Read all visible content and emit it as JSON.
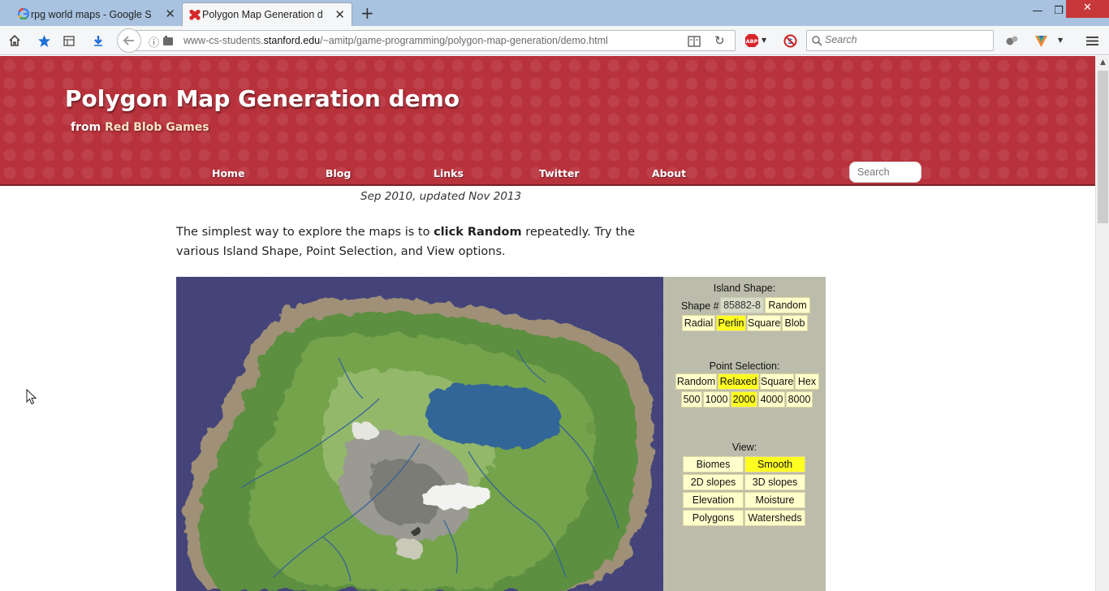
{
  "browser": {
    "tabs": [
      {
        "title": "rpg world maps - Google Se",
        "active": false
      },
      {
        "title": "Polygon Map Generation de",
        "active": true
      }
    ],
    "new_tab": "+",
    "url": {
      "prefix": "www-cs-students.",
      "domain": "stanford.edu",
      "path": "/~amitp/game-programming/polygon-map-generation/demo.html"
    },
    "search_placeholder": "Search",
    "window_controls": {
      "minimize": "—",
      "maximize": "❐",
      "close": "✕"
    }
  },
  "header": {
    "title": "Polygon Map Generation demo",
    "subtitle_prefix": "from ",
    "subtitle_link": "Red Blob Games",
    "nav": [
      "Home",
      "Blog",
      "Links",
      "Twitter",
      "About"
    ],
    "search_placeholder": "Search"
  },
  "content": {
    "date": "Sep 2010, updated Nov 2013",
    "intro_part1": "The simplest way to explore the maps is to ",
    "intro_bold": "click Random",
    "intro_part2": " repeatedly. Try the various Island Shape, Point Selection, and View options."
  },
  "controls": {
    "island_shape_heading": "Island Shape:",
    "shape_label": "Shape #",
    "shape_value": "85882-8",
    "random_label": "Random",
    "shape_types": [
      {
        "label": "Radial",
        "selected": false
      },
      {
        "label": "Perlin",
        "selected": true
      },
      {
        "label": "Square",
        "selected": false
      },
      {
        "label": "Blob",
        "selected": false
      }
    ],
    "point_selection_heading": "Point Selection:",
    "point_types": [
      {
        "label": "Random",
        "selected": false
      },
      {
        "label": "Relaxed",
        "selected": true
      },
      {
        "label": "Square",
        "selected": false
      },
      {
        "label": "Hex",
        "selected": false
      }
    ],
    "point_counts": [
      {
        "label": "500",
        "selected": false
      },
      {
        "label": "1000",
        "selected": false
      },
      {
        "label": "2000",
        "selected": true
      },
      {
        "label": "4000",
        "selected": false
      },
      {
        "label": "8000",
        "selected": false
      }
    ],
    "view_heading": "View:",
    "views": [
      {
        "label": "Biomes",
        "selected": false
      },
      {
        "label": "Smooth",
        "selected": true
      },
      {
        "label": "2D slopes",
        "selected": false
      },
      {
        "label": "3D slopes",
        "selected": false
      },
      {
        "label": "Elevation",
        "selected": false
      },
      {
        "label": "Moisture",
        "selected": false
      },
      {
        "label": "Polygons",
        "selected": false
      },
      {
        "label": "Watersheds",
        "selected": false
      }
    ]
  },
  "colors": {
    "header_red": "#b8323c",
    "ocean": "#44447a",
    "beach": "#a09077",
    "lake": "#336699",
    "control_bg": "#bcbcac",
    "button_bg": "#ffffcc",
    "button_selected": "#ffff22"
  }
}
